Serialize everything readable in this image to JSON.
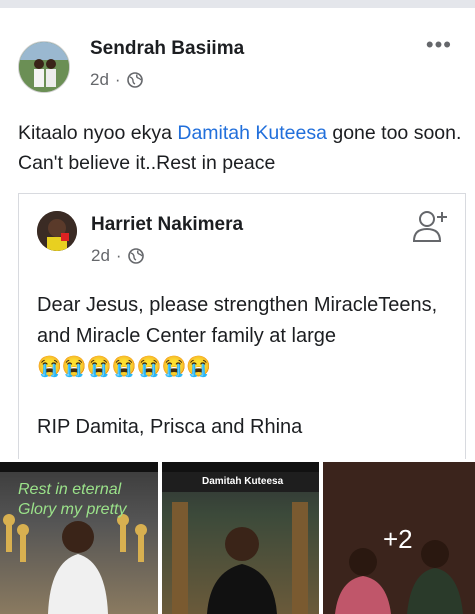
{
  "post": {
    "author": "Sendrah Basiima",
    "time": "2d",
    "separator": "·",
    "more_label": "•••",
    "text_before": "Kitaalo nyoo ekya ",
    "mention": "Damitah Kuteesa",
    "text_after": "  gone too soon. Can't believe it..Rest in peace"
  },
  "shared_post": {
    "author": "Harriet Nakimera",
    "time": "2d",
    "separator": "·",
    "text": "Dear Jesus, please strengthen MiracleTeens, and Miracle Center family at large ",
    "emojis": "😭😭😭😭😭😭😭",
    "rip_text": "RIP Damita, Prisca and Rhina"
  },
  "photos": {
    "photo1_overlay": "Rest in eternal Glory my pretty",
    "photo2_title": "Damitah Kuteesa",
    "photo3_more": "+2"
  },
  "colors": {
    "link": "#216fdb",
    "meta": "#65676b"
  }
}
